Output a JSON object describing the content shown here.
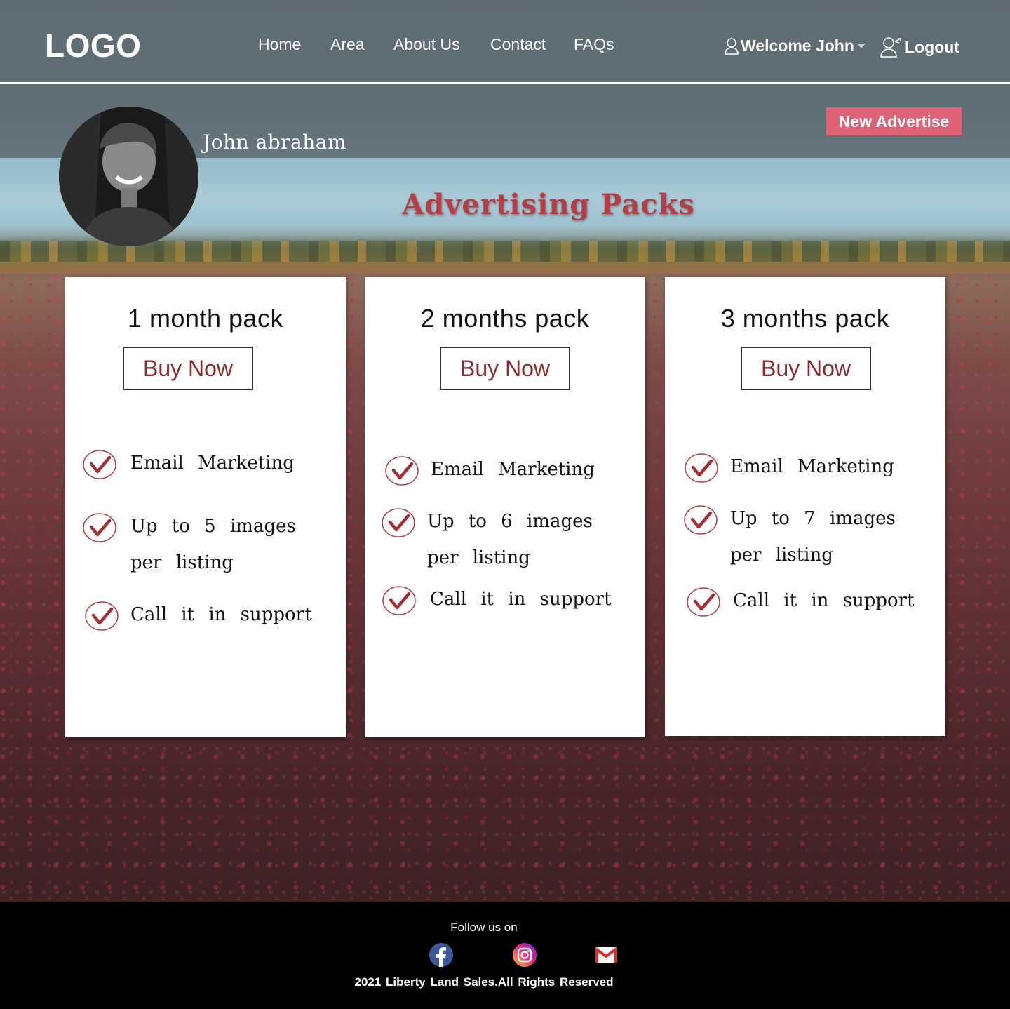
{
  "brand": {
    "logo_text": "LOGO"
  },
  "nav": {
    "items": [
      {
        "label": "Home"
      },
      {
        "label": "Area"
      },
      {
        "label": "About Us"
      },
      {
        "label": "Contact"
      },
      {
        "label": "FAQs"
      }
    ],
    "welcome_label": "Welcome John",
    "logout_label": "Logout"
  },
  "profile": {
    "name": "John abraham",
    "new_ad_label": "New Advertise"
  },
  "section": {
    "title": "Advertising Packs"
  },
  "packs": [
    {
      "name": "1 month pack",
      "button": "Buy Now",
      "features": [
        "Email Marketing",
        "Up to 5 images per listing",
        "Call it in support"
      ]
    },
    {
      "name": "2 months pack",
      "button": "Buy Now",
      "features": [
        "Email Marketing",
        "Up to 6 images per listing",
        "Call it in support"
      ]
    },
    {
      "name": "3 months pack",
      "button": "Buy Now",
      "features": [
        "Email Marketing",
        "Up to 7 images per listing",
        "Call it in support"
      ]
    }
  ],
  "footer": {
    "follow_label": "Follow us on",
    "social": [
      {
        "icon": "facebook-icon"
      },
      {
        "icon": "instagram-icon"
      },
      {
        "icon": "gmail-icon"
      }
    ],
    "copyright": "2021  Liberty  Land Sales.All Rights Reserved"
  },
  "colors": {
    "accent": "#b73d44",
    "button_text": "#8f2a2d",
    "new_ad_bg": "#e06277",
    "header_overlay": "#5f6c74",
    "footer_bg": "#000000"
  }
}
